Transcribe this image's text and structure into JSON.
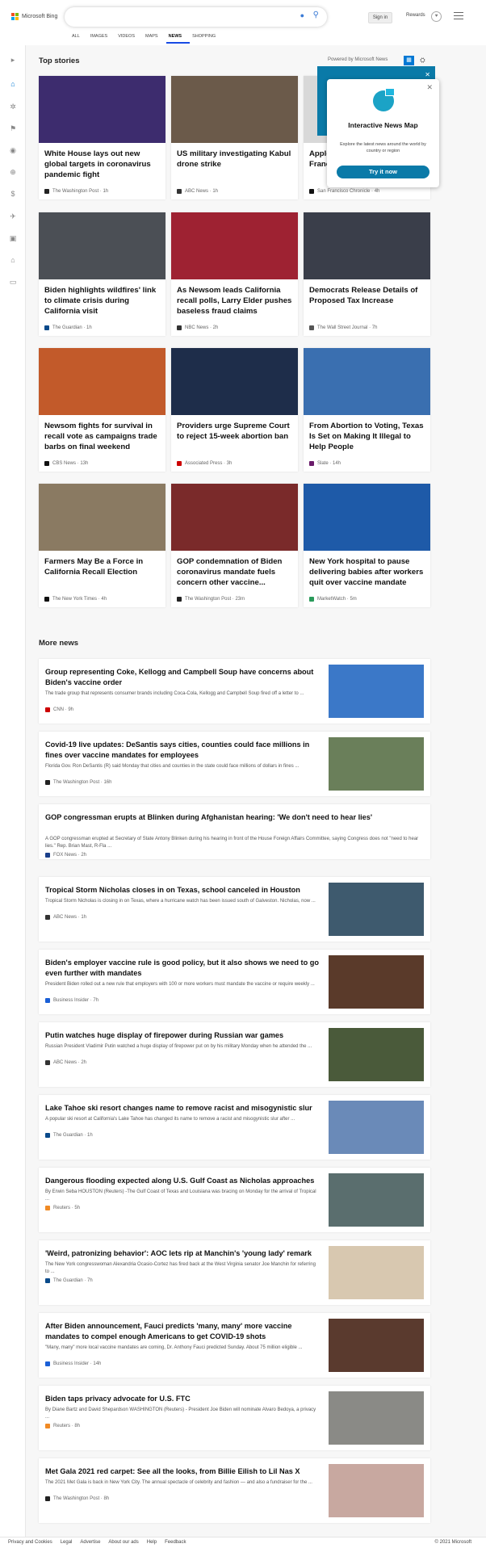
{
  "header": {
    "brand": "Microsoft Bing",
    "sign_in": "Sign in",
    "rewards": "Rewards",
    "nav": [
      "ALL",
      "IMAGES",
      "VIDEOS",
      "MAPS",
      "NEWS",
      "SHOPPING"
    ],
    "active_nav": "NEWS"
  },
  "top_stories": {
    "title": "Top stories",
    "powered_by": "Powered by Microsoft News",
    "cards": [
      {
        "title": "White House lays out new global targets in coronavirus pandemic fight",
        "source": "The Washington Post · 1h",
        "img": "#3d2c6e",
        "fav": "#222"
      },
      {
        "title": "US military investigating Kabul drone strike",
        "source": "ABC News · 1h",
        "img": "#6b5a4a",
        "fav": "#333"
      },
      {
        "title": "Apple stands attributed to San Francisco firm",
        "source": "San Francisco Chronicle · 4h",
        "img": "#d8d8d8",
        "fav": "#111"
      },
      {
        "title": "Biden highlights wildfires' link to climate crisis during California visit",
        "source": "The Guardian · 1h",
        "img": "#4b4f55",
        "fav": "#0a4a8a"
      },
      {
        "title": "As Newsom leads California recall polls, Larry Elder pushes baseless fraud claims",
        "source": "NBC News · 2h",
        "img": "#9e2232",
        "fav": "#333"
      },
      {
        "title": "Democrats Release Details of Proposed Tax Increase",
        "source": "The Wall Street Journal · 7h",
        "img": "#3a3e4a",
        "fav": "#555"
      },
      {
        "title": "Newsom fights for survival in recall vote as campaigns trade barbs on final weekend",
        "source": "CBS News · 13h",
        "img": "#c25a2a",
        "fav": "#111"
      },
      {
        "title": "Providers urge Supreme Court to reject 15-week abortion ban",
        "source": "Associated Press · 3h",
        "img": "#1e2d4a",
        "fav": "#c00"
      },
      {
        "title": "From Abortion to Voting, Texas Is Set on Making It Illegal to Help People",
        "source": "Slate · 14h",
        "img": "#3a6fb0",
        "fav": "#6a1b6a"
      },
      {
        "title": "Farmers May Be a Force in California Recall Election",
        "source": "The New York Times · 4h",
        "img": "#8a7a62",
        "fav": "#111"
      },
      {
        "title": "GOP condemnation of Biden coronavirus mandate fuels concern other vaccine...",
        "source": "The Washington Post · 23m",
        "img": "#7a2a2a",
        "fav": "#222"
      },
      {
        "title": "New York hospital to pause delivering babies after workers quit over vaccine mandate",
        "source": "MarketWatch · 5m",
        "img": "#1e5aa8",
        "fav": "#2a9a5a"
      }
    ]
  },
  "popup": {
    "title": "Interactive News Map",
    "description": "Explore the latest news around the world by country or region",
    "button": "Try it now"
  },
  "more_news": {
    "title": "More news",
    "items": [
      {
        "title": "Group representing Coke, Kellogg and Campbell Soup have concerns about Biden's vaccine order",
        "desc": "The trade group that represents consumer brands including Coca-Cola, Kellogg and Campbell Soup fired off a letter to ...",
        "source": "CNN · 9h",
        "fav": "#c00",
        "img": "#3b78c8"
      },
      {
        "title": "Covid-19 live updates: DeSantis says cities, counties could face millions in fines over vaccine mandates for employees",
        "desc": "Florida Gov. Ron DeSantis (R) said Monday that cities and counties in the state could face millions of dollars in fines ...",
        "source": "The Washington Post · 16h",
        "fav": "#222",
        "img": "#6a7f5a"
      },
      {
        "title": "GOP congressman erupts at Blinken during Afghanistan hearing: 'We don't need to hear lies'",
        "desc": "A GOP congressman erupted at Secretary of State Antony Blinken during his hearing in front of the House Foreign Affairs Committee, saying Congress does not \"need to hear lies.\" Rep. Brian Mast, R-Fla ...",
        "source": "FOX News · 2h",
        "fav": "#1a3f8a",
        "img": null
      },
      {
        "title": "Tropical Storm Nicholas closes in on Texas, school canceled in Houston",
        "desc": "Tropical Storm Nicholas is closing in on Texas, where a hurricane watch has been issued south of Galveston. Nicholas, now ...",
        "source": "ABC News · 1h",
        "fav": "#333",
        "img": "#3e5a6e"
      },
      {
        "title": "Biden's employer vaccine rule is good policy, but it also shows we need to go even further with mandates",
        "desc": "President Biden rolled out a new rule that employers with 100 or more workers must mandate the vaccine or require weekly ...",
        "source": "Business Insider · 7h",
        "fav": "#1a5fd6",
        "img": "#5a3a2a"
      },
      {
        "title": "Putin watches huge display of firepower during Russian war games",
        "desc": "Russian President Vladimir Putin watched a huge display of firepower put on by his military Monday when he attended the ...",
        "source": "ABC News · 2h",
        "fav": "#333",
        "img": "#4a5a3a"
      },
      {
        "title": "Lake Tahoe ski resort changes name to remove racist and misogynistic slur",
        "desc": "A popular ski resort at California's Lake Tahoe has changed its name to remove a racist and misogynistic slur after ...",
        "source": "The Guardian · 1h",
        "fav": "#0a4a8a",
        "img": "#6a8ab8"
      },
      {
        "title": "Dangerous flooding expected along U.S. Gulf Coast as Nicholas approaches",
        "desc": "By Erwin Seba HOUSTON (Reuters) -The Gulf Coast of Texas and Louisiana was bracing on Monday for the arrival of Tropical ...",
        "source": "Reuters · 5h",
        "fav": "#f08a24",
        "img": "#5a6e6e"
      },
      {
        "title": "'Weird, patronizing behavior': AOC lets rip at Manchin's 'young lady' remark",
        "desc": "The New York congresswoman Alexandria Ocasio-Cortez has fired back at the West Virginia senator Joe Manchin for referring to ...",
        "source": "The Guardian · 7h",
        "fav": "#0a4a8a",
        "img": "#d8c8b0"
      },
      {
        "title": "After Biden announcement, Fauci predicts 'many, many' more vaccine mandates to compel enough Americans to get COVID-19 shots",
        "desc": "\"Many, many\" more local vaccine mandates are coming, Dr. Anthony Fauci predicted Sunday. About 75 million eligible ...",
        "source": "Business Insider · 14h",
        "fav": "#1a5fd6",
        "img": "#5a3a2e"
      },
      {
        "title": "Biden taps privacy advocate for U.S. FTC",
        "desc": "By Diane Bartz and David Shepardson WASHINGTON (Reuters) - President Joe Biden will nominate Alvaro Bedoya, a privacy ...",
        "source": "Reuters · 8h",
        "fav": "#f08a24",
        "img": "#8a8a86"
      },
      {
        "title": "Met Gala 2021 red carpet: See all the looks, from Billie Eilish to Lil Nas X",
        "desc": "The 2021 Met Gala is back in New York City. The annual spectacle of celebrity and fashion — and also a fundraiser for the ...",
        "source": "The Washington Post · 8h",
        "fav": "#222",
        "img": "#c8a8a0"
      }
    ]
  },
  "footer": {
    "links": [
      "Privacy and Cookies",
      "Legal",
      "Advertise",
      "About our ads",
      "Help",
      "Feedback"
    ],
    "copyright": "© 2021 Microsoft"
  },
  "colors": {
    "accent": "#0078d4",
    "teal": "#0a7aa8",
    "nav_underline": "#174ae4"
  }
}
